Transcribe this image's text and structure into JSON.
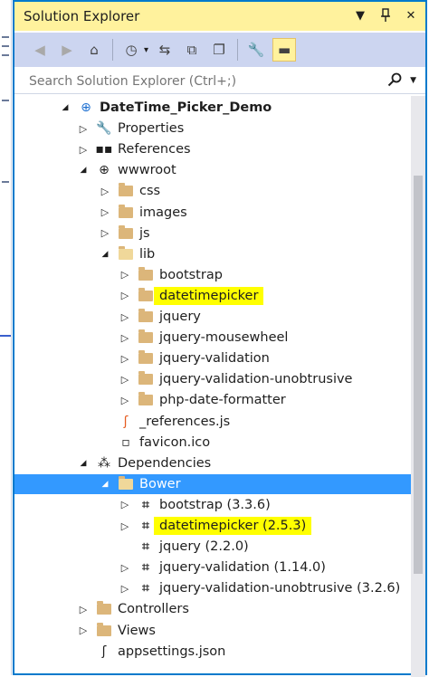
{
  "window": {
    "title": "Solution Explorer",
    "dropdown_glyph": "▼",
    "pin_glyph": "📌",
    "close_glyph": "✕"
  },
  "toolbar": {
    "buttons": [
      {
        "name": "back-icon",
        "glyph": "◀"
      },
      {
        "name": "forward-icon",
        "glyph": "▶"
      },
      {
        "name": "home-icon",
        "glyph": "⌂"
      },
      {
        "name": "history-icon",
        "glyph": "◷"
      },
      {
        "name": "sync-icon",
        "glyph": "⇆"
      },
      {
        "name": "collapse-all-icon",
        "glyph": "⧉"
      },
      {
        "name": "show-all-files-icon",
        "glyph": "❐"
      },
      {
        "name": "properties-wrench-icon",
        "glyph": "🔧"
      },
      {
        "name": "preview-icon",
        "glyph": "▬"
      }
    ]
  },
  "search": {
    "placeholder": "Search Solution Explorer (Ctrl+;)",
    "icon": "search-icon",
    "dropdown_glyph": "▼"
  },
  "tree": [
    {
      "label": "DateTime_Picker_Demo",
      "level": 0,
      "expanded": true,
      "icon": "web-project-icon",
      "glyph": "⊕"
    },
    {
      "label": "Properties",
      "level": 1,
      "expanded": false,
      "icon": "wrench-icon",
      "glyph": "🔧"
    },
    {
      "label": "References",
      "level": 1,
      "expanded": false,
      "icon": "references-icon",
      "glyph": "▪▪"
    },
    {
      "label": "wwwroot",
      "level": 1,
      "expanded": true,
      "icon": "globe-icon",
      "glyph": "⊕"
    },
    {
      "label": "css",
      "level": 2,
      "expanded": false,
      "icon": "folder-icon"
    },
    {
      "label": "images",
      "level": 2,
      "expanded": false,
      "icon": "folder-icon"
    },
    {
      "label": "js",
      "level": 2,
      "expanded": false,
      "icon": "folder-icon"
    },
    {
      "label": "lib",
      "level": 2,
      "expanded": true,
      "icon": "folder-open-icon"
    },
    {
      "label": "bootstrap",
      "level": 3,
      "expanded": false,
      "icon": "folder-icon"
    },
    {
      "label": "datetimepicker",
      "level": 3,
      "expanded": false,
      "icon": "folder-icon",
      "highlight": true
    },
    {
      "label": "jquery",
      "level": 3,
      "expanded": false,
      "icon": "folder-icon"
    },
    {
      "label": "jquery-mousewheel",
      "level": 3,
      "expanded": false,
      "icon": "folder-icon"
    },
    {
      "label": "jquery-validation",
      "level": 3,
      "expanded": false,
      "icon": "folder-icon"
    },
    {
      "label": "jquery-validation-unobtrusive",
      "level": 3,
      "expanded": false,
      "icon": "folder-icon"
    },
    {
      "label": "php-date-formatter",
      "level": 3,
      "expanded": false,
      "icon": "folder-icon"
    },
    {
      "label": "_references.js",
      "level": 2,
      "leaf": true,
      "icon": "js-file-icon",
      "glyph": "ʃ"
    },
    {
      "label": "favicon.ico",
      "level": 2,
      "leaf": true,
      "icon": "ico-file-icon",
      "glyph": "▫"
    },
    {
      "label": "Dependencies",
      "level": 1,
      "expanded": true,
      "icon": "dependencies-icon",
      "glyph": "⁂"
    },
    {
      "label": "Bower",
      "level": 2,
      "expanded": true,
      "icon": "bower-icon",
      "selected": true
    },
    {
      "label": "bootstrap (3.3.6)",
      "level": 3,
      "expanded": false,
      "icon": "package-icon",
      "glyph": "⌗"
    },
    {
      "label": "datetimepicker (2.5.3)",
      "level": 3,
      "expanded": false,
      "icon": "package-icon",
      "glyph": "⌗",
      "highlight": true
    },
    {
      "label": "jquery (2.2.0)",
      "level": 3,
      "leaf": true,
      "icon": "package-icon",
      "glyph": "⌗"
    },
    {
      "label": "jquery-validation (1.14.0)",
      "level": 3,
      "expanded": false,
      "icon": "package-icon",
      "glyph": "⌗"
    },
    {
      "label": "jquery-validation-unobtrusive (3.2.6)",
      "level": 3,
      "expanded": false,
      "icon": "package-icon",
      "glyph": "⌗"
    },
    {
      "label": "Controllers",
      "level": 1,
      "expanded": false,
      "icon": "folder-icon"
    },
    {
      "label": "Views",
      "level": 1,
      "expanded": false,
      "icon": "folder-icon"
    },
    {
      "label": "appsettings.json",
      "level": 1,
      "leaf": true,
      "icon": "json-file-icon",
      "glyph": "ʃ"
    }
  ],
  "colors": {
    "accent": "#007acc",
    "title_bar": "#fff29d",
    "toolbar": "#ccd5f0",
    "selection": "#3399ff",
    "highlight": "#ffff00",
    "folder": "#dcb67a"
  }
}
